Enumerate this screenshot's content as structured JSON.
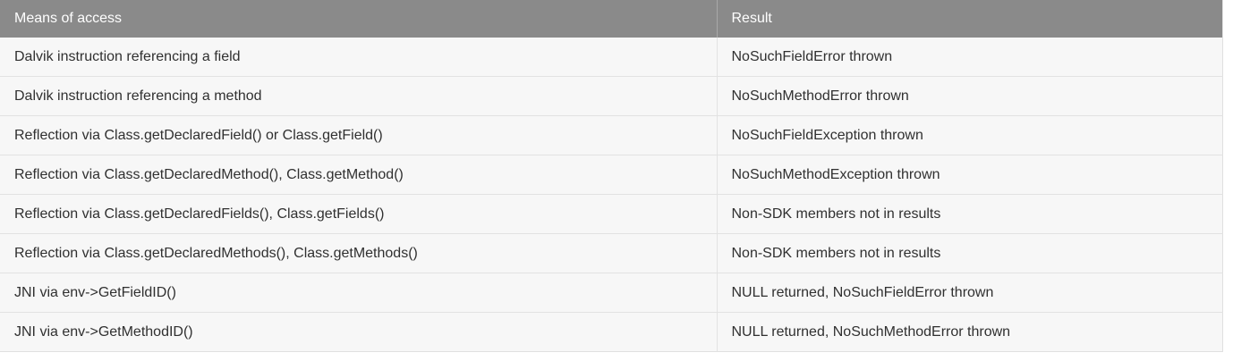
{
  "table": {
    "headers": {
      "means_of_access": "Means of access",
      "result": "Result"
    },
    "rows": [
      {
        "access": "Dalvik instruction referencing a field",
        "result": "NoSuchFieldError thrown"
      },
      {
        "access": "Dalvik instruction referencing a method",
        "result": "NoSuchMethodError thrown"
      },
      {
        "access": "Reflection via Class.getDeclaredField() or Class.getField()",
        "result": "NoSuchFieldException thrown"
      },
      {
        "access": "Reflection via Class.getDeclaredMethod(), Class.getMethod()",
        "result": "NoSuchMethodException thrown"
      },
      {
        "access": "Reflection via Class.getDeclaredFields(), Class.getFields()",
        "result": "Non-SDK members not in results"
      },
      {
        "access": "Reflection via Class.getDeclaredMethods(), Class.getMethods()",
        "result": "Non-SDK members not in results"
      },
      {
        "access": "JNI via env->GetFieldID()",
        "result": "NULL returned, NoSuchFieldError thrown"
      },
      {
        "access": "JNI via env->GetMethodID()",
        "result": "NULL returned, NoSuchMethodError thrown"
      }
    ]
  },
  "colors": {
    "header_background": "#8a8a8a",
    "header_text": "#ffffff",
    "row_background": "#f7f7f7",
    "row_text": "#303030",
    "border": "#e2e2e2"
  }
}
